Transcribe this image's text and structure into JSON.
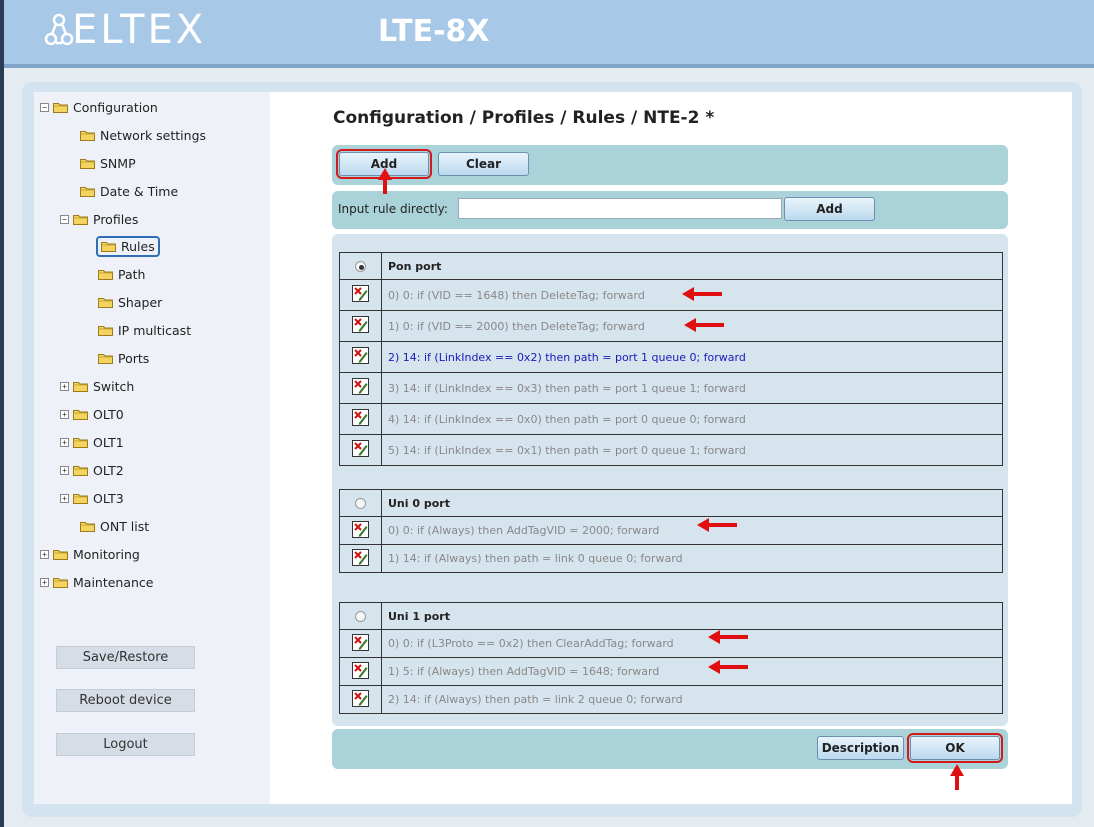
{
  "header": {
    "brand": "ELTEX",
    "device": "LTE-8X"
  },
  "sidebar": {
    "items": [
      {
        "label": "Configuration",
        "expander": "minus"
      },
      {
        "label": "Network settings"
      },
      {
        "label": "SNMP"
      },
      {
        "label": "Date & Time"
      },
      {
        "label": "Profiles",
        "expander": "minus"
      },
      {
        "label": "Rules",
        "selected": true
      },
      {
        "label": "Path"
      },
      {
        "label": "Shaper"
      },
      {
        "label": "IP multicast"
      },
      {
        "label": "Ports"
      },
      {
        "label": "Switch",
        "expander": "plus"
      },
      {
        "label": "OLT0",
        "expander": "plus"
      },
      {
        "label": "OLT1",
        "expander": "plus"
      },
      {
        "label": "OLT2",
        "expander": "plus"
      },
      {
        "label": "OLT3",
        "expander": "plus"
      },
      {
        "label": "ONT list"
      },
      {
        "label": "Monitoring",
        "expander": "plus"
      },
      {
        "label": "Maintenance",
        "expander": "plus"
      }
    ],
    "buttons": {
      "save_restore": "Save/Restore",
      "reboot": "Reboot device",
      "logout": "Logout"
    }
  },
  "main": {
    "title": "Configuration / Profiles / Rules / NTE-2 *",
    "toolbar": {
      "add": "Add",
      "clear": "Clear"
    },
    "direct_input": {
      "label": "Input rule directly:",
      "value": "",
      "add": "Add"
    },
    "groups": [
      {
        "port": "Pon port",
        "selected": true,
        "rules": [
          {
            "text": "0) 0: if (VID == 1648) then DeleteTag; forward",
            "arrow": true
          },
          {
            "text": "1) 0: if (VID == 2000) then DeleteTag; forward",
            "arrow": true
          },
          {
            "text": "2) 14: if (LinkIndex == 0x2) then path = port 1 queue 0; forward",
            "active": true
          },
          {
            "text": "3) 14: if (LinkIndex == 0x3) then path = port 1 queue 1; forward"
          },
          {
            "text": "4) 14: if (LinkIndex == 0x0) then path = port 0 queue 0; forward"
          },
          {
            "text": "5) 14: if (LinkIndex == 0x1) then path = port 0 queue 1; forward"
          }
        ]
      },
      {
        "port": "Uni 0 port",
        "selected": false,
        "rules": [
          {
            "text": "0) 0: if (Always) then AddTagVID = 2000; forward",
            "arrow": true
          },
          {
            "text": "1) 14: if (Always) then path = link 0 queue 0; forward"
          }
        ]
      },
      {
        "port": "Uni 1 port",
        "selected": false,
        "rules": [
          {
            "text": "0) 0: if (L3Proto == 0x2) then ClearAddTag; forward",
            "arrow": true
          },
          {
            "text": "1) 5: if (Always) then AddTagVID = 1648; forward",
            "arrow": true
          },
          {
            "text": "2) 14: if (Always) then path = link 2 queue 0; forward"
          }
        ]
      }
    ],
    "footer": {
      "description": "Description",
      "ok": "OK"
    }
  },
  "colors": {
    "annotation": "#e01010",
    "active_rule": "#1a1ab8",
    "panel": "#a9d2d9"
  }
}
